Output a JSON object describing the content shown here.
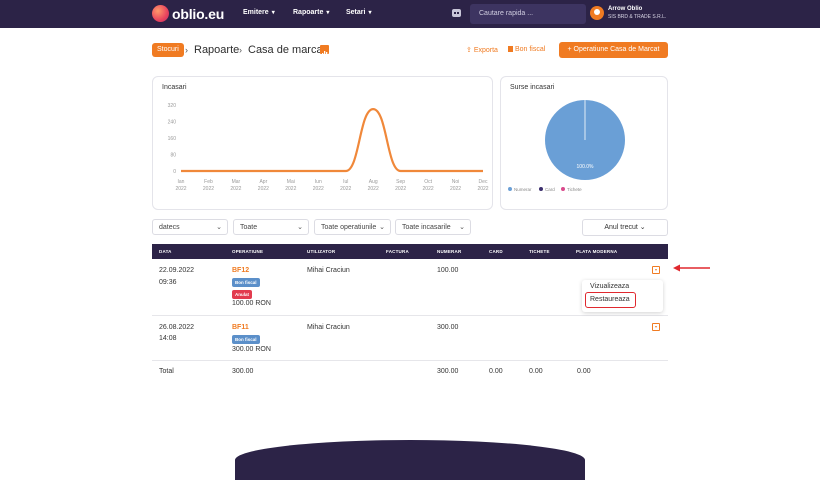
{
  "header": {
    "logo": "oblio.eu",
    "nav": [
      "Emitere",
      "Rapoarte",
      "Setari"
    ],
    "search_placeholder": "Cautare rapida ...",
    "user": {
      "name": "Arrow Oblio",
      "company": "SIS BRD & TRADE S.R.L."
    }
  },
  "breadcrumb": {
    "badge": "Stocuri",
    "items": [
      "Rapoarte",
      "Casa de marcat"
    ],
    "separator": "›"
  },
  "actions": {
    "export": "Exporta",
    "bon_fiscal": "Bon fiscal",
    "primary": "Operatiune Casa de Marcat",
    "plus": "+",
    "upload_glyph": "⇪"
  },
  "income_chart": {
    "title": "Incasari",
    "y_ticks": [
      "0",
      "80",
      "160",
      "240",
      "320"
    ],
    "months": [
      [
        "Ian",
        "2022"
      ],
      [
        "Feb",
        "2022"
      ],
      [
        "Mar",
        "2022"
      ],
      [
        "Apr",
        "2022"
      ],
      [
        "Mai",
        "2022"
      ],
      [
        "Iun",
        "2022"
      ],
      [
        "Iul",
        "2022"
      ],
      [
        "Aug",
        "2022"
      ],
      [
        "Sep",
        "2022"
      ],
      [
        "Oct",
        "2022"
      ],
      [
        "Noi",
        "2022"
      ],
      [
        "Dec",
        "2022"
      ]
    ]
  },
  "chart_data": [
    {
      "type": "line",
      "title": "Incasari",
      "categories": [
        "Ian 2022",
        "Feb 2022",
        "Mar 2022",
        "Apr 2022",
        "Mai 2022",
        "Iun 2022",
        "Iul 2022",
        "Aug 2022",
        "Sep 2022",
        "Oct 2022",
        "Noi 2022",
        "Dec 2022"
      ],
      "values": [
        0,
        0,
        0,
        0,
        0,
        0,
        0,
        300,
        0,
        0,
        0,
        0
      ],
      "ylim": [
        0,
        320
      ],
      "color": "#f0883a"
    },
    {
      "type": "pie",
      "title": "Surse incasari",
      "categories": [
        "Numerar",
        "Card",
        "Tichete"
      ],
      "values": [
        100,
        0,
        0
      ],
      "slice_label": "100.0%",
      "colors": [
        "#6a9fd6",
        "#3c2f6e",
        "#d94a8c"
      ],
      "legend": "bottom"
    }
  ],
  "sources_chart": {
    "title": "Surse incasari",
    "slice_label": "100.0%",
    "legend": [
      "Numerar",
      "Card",
      "Tichete"
    ]
  },
  "filters": {
    "date": "datecs",
    "all": "Toate",
    "operations": "Toate operatiunile",
    "receipts": "Toate incasarile",
    "year": "Anul trecut",
    "caret": "⌄"
  },
  "table": {
    "headers": [
      "DATA",
      "OPERATIUNE",
      "UTILIZATOR",
      "FACTURA",
      "NUMERAR",
      "CARD",
      "TICHETE",
      "PLATA MODERNA"
    ],
    "rows": [
      {
        "date": "22.09.2022",
        "time": "09:36",
        "op": "BF12",
        "badges": [
          "Bon fiscal",
          "Anulat"
        ],
        "amount": "100.00 RON",
        "user": "Mihai Craciun",
        "cash": "100.00"
      },
      {
        "date": "26.08.2022",
        "time": "14:08",
        "op": "BF11",
        "badges": [
          "Bon fiscal"
        ],
        "amount": "300.00 RON",
        "user": "Mihai Craciun",
        "cash": "300.00"
      }
    ],
    "total": {
      "label": "Total",
      "amount": "300.00",
      "cash": "300.00",
      "card": "0.00",
      "tickets": "0.00",
      "modern": "0.00"
    }
  },
  "dropdown": {
    "items": [
      "Vizualizeaza",
      "Restaureaza"
    ]
  },
  "colors": {
    "accent": "#f07b22",
    "navbar": "#2c2347",
    "danger": "#e23b4e",
    "info": "#5b8fc9"
  }
}
